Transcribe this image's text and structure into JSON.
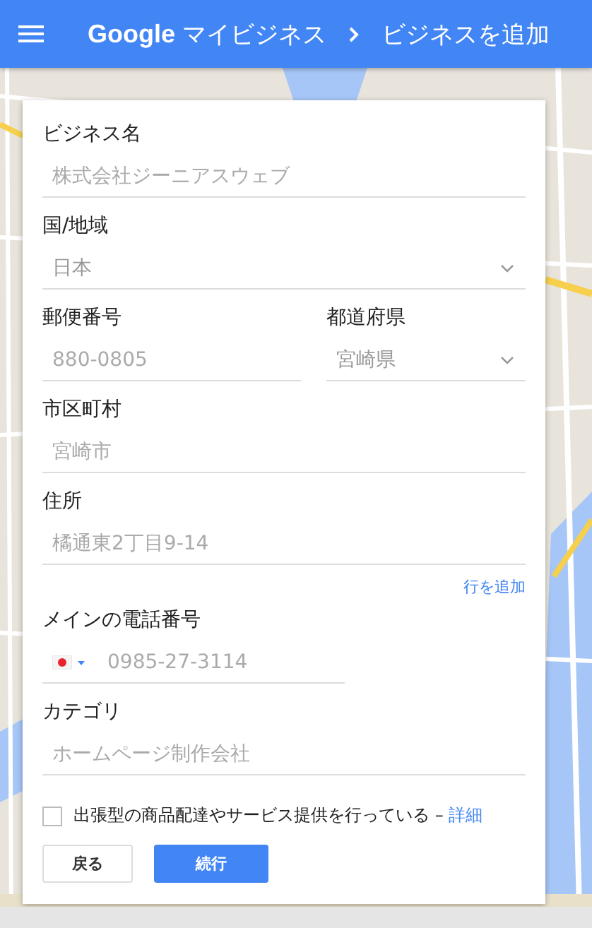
{
  "header": {
    "brand": "Google",
    "product": "マイビジネス",
    "title": "ビジネスを追加"
  },
  "form": {
    "rows": [
      {
        "kind": "single",
        "fields": [
          {
            "kind": "text",
            "label": "ビジネス名",
            "placeholder": "株式会社ジーニアスウェブ"
          }
        ]
      },
      {
        "kind": "single",
        "fields": [
          {
            "kind": "select",
            "label": "国/地域",
            "value": "日本"
          }
        ]
      },
      {
        "kind": "pair",
        "fields": [
          {
            "kind": "text",
            "label": "郵便番号",
            "placeholder": "880-0805"
          },
          {
            "kind": "select",
            "label": "都道府県",
            "value": "宮崎県"
          }
        ]
      },
      {
        "kind": "single",
        "fields": [
          {
            "kind": "text",
            "label": "市区町村",
            "placeholder": "宮崎市"
          }
        ]
      },
      {
        "kind": "single",
        "fields": [
          {
            "kind": "text",
            "label": "住所",
            "placeholder": "橘通東2丁目9-14"
          }
        ]
      }
    ],
    "add_line": "行を追加",
    "phone": {
      "label": "メインの電話番号",
      "placeholder": "0985-27-3114"
    },
    "category": {
      "label": "カテゴリ",
      "placeholder": "ホームページ制作会社"
    },
    "service_area": {
      "checked": false,
      "label": "出張型の商品配達やサービス提供を行っている – ",
      "link": "詳細"
    },
    "buttons": [
      {
        "kind": "secondary",
        "label": "戻る"
      },
      {
        "kind": "primary",
        "label": "続行"
      }
    ]
  }
}
